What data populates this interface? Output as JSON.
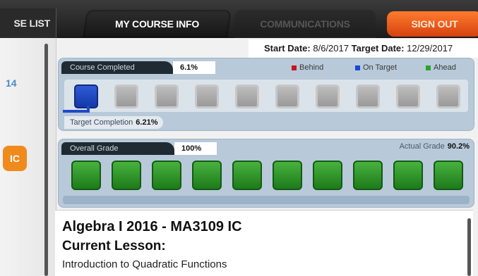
{
  "tabs": {
    "course_list": "SE LIST",
    "my_course_info": "MY COURSE INFO",
    "communications": "COMMUNICATIONS",
    "sign_out": "SIGN OUT"
  },
  "sidebar": {
    "partial_number": "14",
    "partial_badge": "IC"
  },
  "dates": {
    "start_label": "Start Date:",
    "start_value": "8/6/2017",
    "target_label": "Target Date:",
    "target_value": "12/29/2017"
  },
  "course_completed": {
    "label": "Course Completed",
    "percent": "6.1%",
    "legend": {
      "behind": "Behind",
      "on_target": "On Target",
      "ahead": "Ahead"
    },
    "target_label": "Target Completion",
    "target_percent": "6.21%",
    "boxes_total": 10,
    "boxes_completed": 1
  },
  "overall_grade": {
    "label": "Overall Grade",
    "percent": "100%",
    "actual_label": "Actual Grade",
    "actual_value": "90.2%",
    "boxes_total": 10
  },
  "course": {
    "title": "Algebra I 2016 - MA3109 IC",
    "current_lesson_label": "Current Lesson:",
    "lesson_name": "Introduction to Quadratic Functions"
  },
  "colors": {
    "behind": "#c8161d",
    "on_target": "#1848d8",
    "ahead": "#2aa52a",
    "sign_out": "#f2661b"
  }
}
